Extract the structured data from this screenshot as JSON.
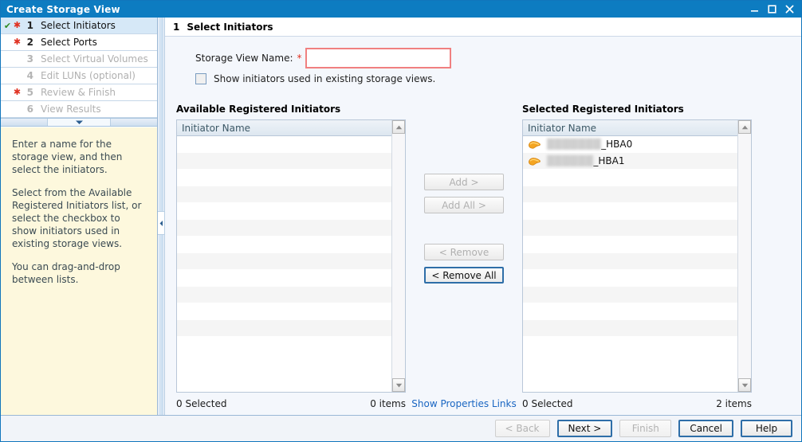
{
  "window": {
    "title": "Create Storage View",
    "controls": [
      {
        "name": "minimize-button",
        "glyph": "minimize-icon"
      },
      {
        "name": "maximize-button",
        "glyph": "maximize-icon"
      },
      {
        "name": "close-button",
        "glyph": "close-icon"
      }
    ]
  },
  "wizard": {
    "steps": [
      {
        "num": "1",
        "label": "Select Initiators",
        "done": "✔",
        "required": "✱",
        "state": "current"
      },
      {
        "num": "2",
        "label": "Select Ports",
        "done": "",
        "required": "✱",
        "state": "enabled"
      },
      {
        "num": "3",
        "label": "Select Virtual Volumes",
        "done": "",
        "required": "",
        "state": "disabled"
      },
      {
        "num": "4",
        "label": "Edit LUNs (optional)",
        "done": "",
        "required": "",
        "state": "disabled"
      },
      {
        "num": "5",
        "label": "Review & Finish",
        "done": "",
        "required": "✱",
        "state": "disabled"
      },
      {
        "num": "6",
        "label": "View Results",
        "done": "",
        "required": "",
        "state": "disabled"
      }
    ]
  },
  "help": {
    "paragraphs": [
      "Enter a name for the storage view, and then select the initiators.",
      "Select from the Available Registered Initiators list, or select the checkbox to show initiators used in existing storage views.",
      "You can drag-and-drop between lists."
    ]
  },
  "page": {
    "step_number": "1",
    "title": "Select Initiators",
    "name_label": "Storage View Name:",
    "required_marker": "*",
    "name_value": "",
    "name_placeholder": "",
    "show_existing_label": "Show initiators used in existing storage views.",
    "show_existing_checked": false
  },
  "available": {
    "title": "Available Registered Initiators",
    "column": "Initiator Name",
    "rows": [],
    "empty_row_count": 13,
    "selected_text": "0 Selected",
    "items_text": "0 items"
  },
  "selected": {
    "title": "Selected Registered Initiators",
    "column": "Initiator Name",
    "rows": [
      {
        "icon": "hba-initiator-icon",
        "redacted": "███████",
        "visible": "_HBA0"
      },
      {
        "icon": "hba-initiator-icon",
        "redacted": "██████",
        "visible": "_HBA1"
      }
    ],
    "empty_row_count": 11,
    "selected_text": "0 Selected",
    "items_text": "2 items"
  },
  "transfer_buttons": [
    {
      "label": "Add >",
      "enabled": false,
      "name": "add-button"
    },
    {
      "label": "Add All >",
      "enabled": false,
      "name": "add-all-button"
    },
    {
      "label": "< Remove",
      "enabled": false,
      "name": "remove-button"
    },
    {
      "label": "< Remove All",
      "enabled": true,
      "name": "remove-all-button"
    }
  ],
  "properties_link": "Show Properties Links",
  "footer_buttons": [
    {
      "label": "< Back",
      "enabled": false,
      "name": "back-button"
    },
    {
      "label": "Next >",
      "enabled": true,
      "name": "next-button"
    },
    {
      "label": "Finish",
      "enabled": false,
      "name": "finish-button"
    },
    {
      "label": "Cancel",
      "enabled": true,
      "name": "cancel-button"
    },
    {
      "label": "Help",
      "enabled": true,
      "name": "help-button"
    }
  ],
  "colors": {
    "titlebar": "#0d7cc1",
    "accent": "#1a66c2",
    "required": "#e03020",
    "help_background": "#fdf8dd",
    "current_step": "#d6e8f7",
    "focus_border": "#2e6ea8"
  }
}
